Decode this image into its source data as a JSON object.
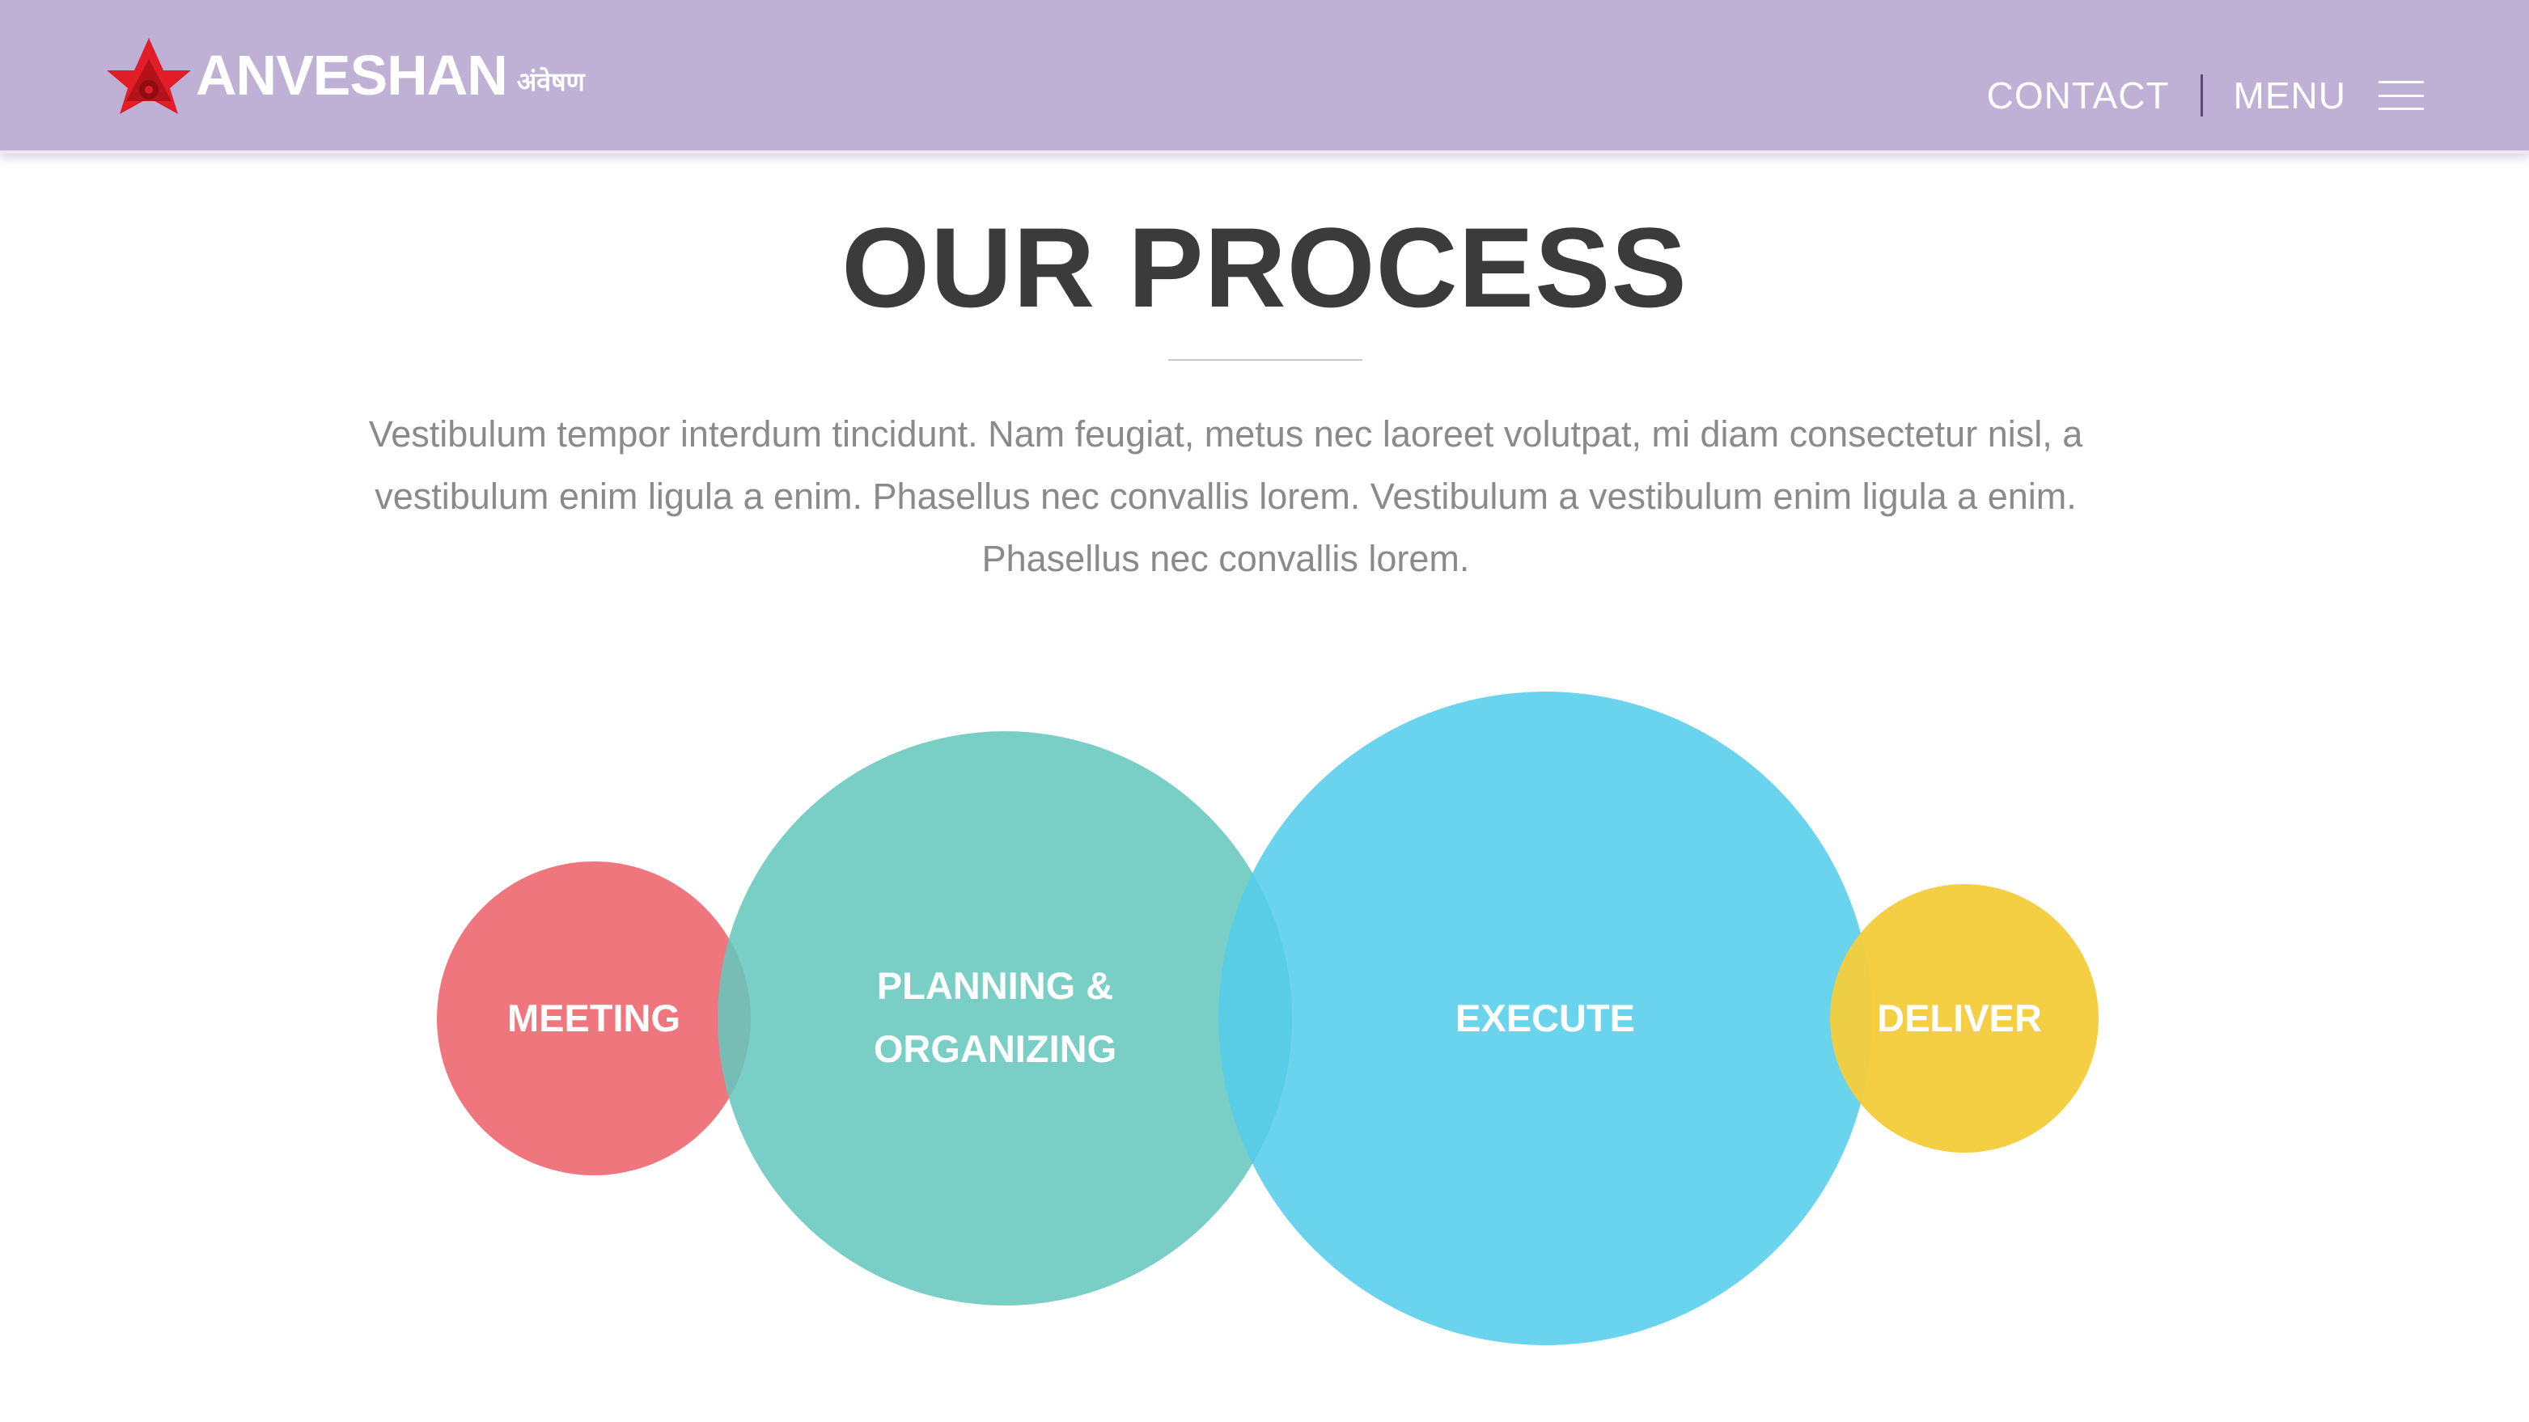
{
  "header": {
    "brand": "ANVESHAN",
    "brand_sub": "अंवेषण",
    "logo_icon": "star-eye-logo-icon",
    "nav": {
      "contact": "CONTACT",
      "menu": "MENU"
    },
    "menu_icon": "hamburger-icon",
    "background_color": "#bfb0d5"
  },
  "main": {
    "title": "OUR PROCESS",
    "intro_lines": [
      "Vestibulum tempor interdum tincidunt. Nam feugiat, metus nec laoreet volutpat, mi diam consectetur nisl, a",
      "vestibulum enim ligula a enim. Phasellus nec convallis lorem. Vestibulum a vestibulum enim ligula a enim.",
      "Phasellus nec convallis lorem."
    ]
  },
  "process_steps": [
    {
      "line1": "MEETING",
      "line2": "",
      "color": "#f0737a"
    },
    {
      "line1": "PLANNING &",
      "line2": "ORGANIZING",
      "color": "#76cfc6"
    },
    {
      "line1": "EXECUTE",
      "line2": "",
      "color": "#5fd0ec"
    },
    {
      "line1": "DELIVER",
      "line2": "",
      "color": "#f4cd3c"
    }
  ]
}
